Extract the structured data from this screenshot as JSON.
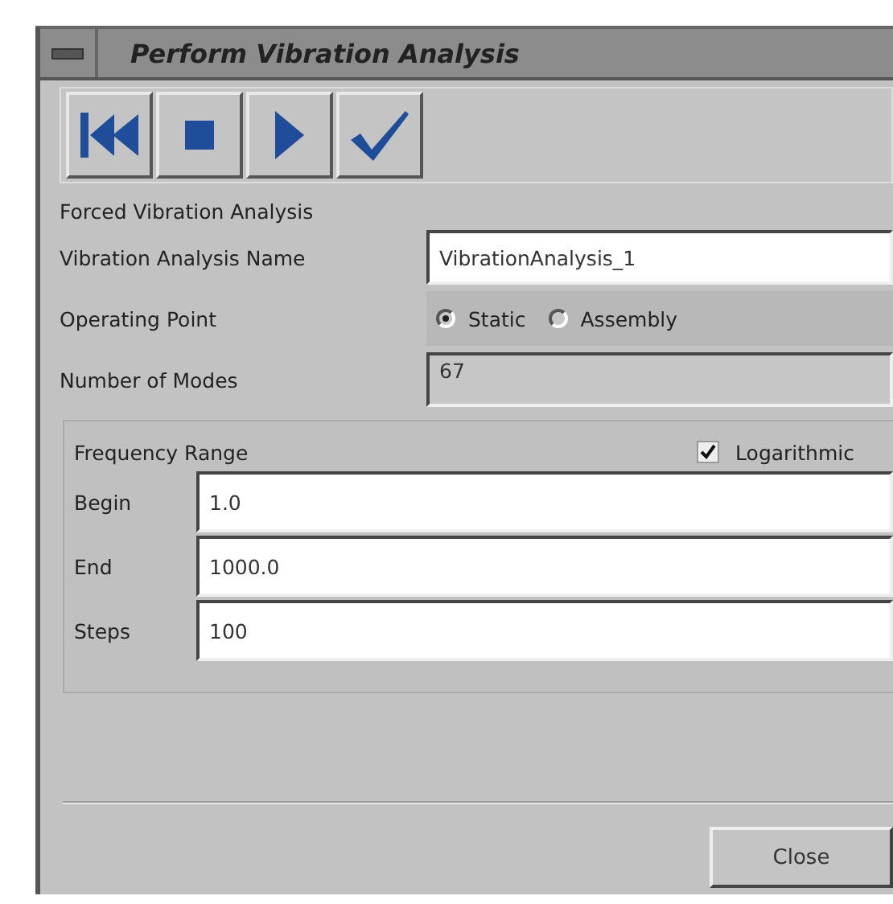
{
  "window": {
    "title": "Perform Vibration Analysis"
  },
  "toolbar": [
    {
      "kind": "rewind"
    },
    {
      "kind": "stop"
    },
    {
      "kind": "play"
    },
    {
      "kind": "apply"
    }
  ],
  "section_title": "Forced Vibration Analysis",
  "fields": [
    {
      "kind": "text",
      "label": "Vibration Analysis Name",
      "value": "VibrationAnalysis_1"
    },
    {
      "kind": "radio",
      "label": "Operating Point",
      "options": [
        {
          "label": "Static",
          "selected": true
        },
        {
          "label": "Assembly",
          "selected": false
        }
      ]
    },
    {
      "kind": "readonly",
      "label": "Number of Modes",
      "value": "67"
    }
  ],
  "frequency_range": {
    "title": "Frequency Range",
    "logarithmic": {
      "label": "Logarithmic",
      "checked": true
    },
    "fields": [
      {
        "label": "Begin",
        "value": "1.0"
      },
      {
        "label": "End",
        "value": "1000.0"
      },
      {
        "label": "Steps",
        "value": "100"
      }
    ]
  },
  "buttons": [
    {
      "label": "Close"
    }
  ]
}
